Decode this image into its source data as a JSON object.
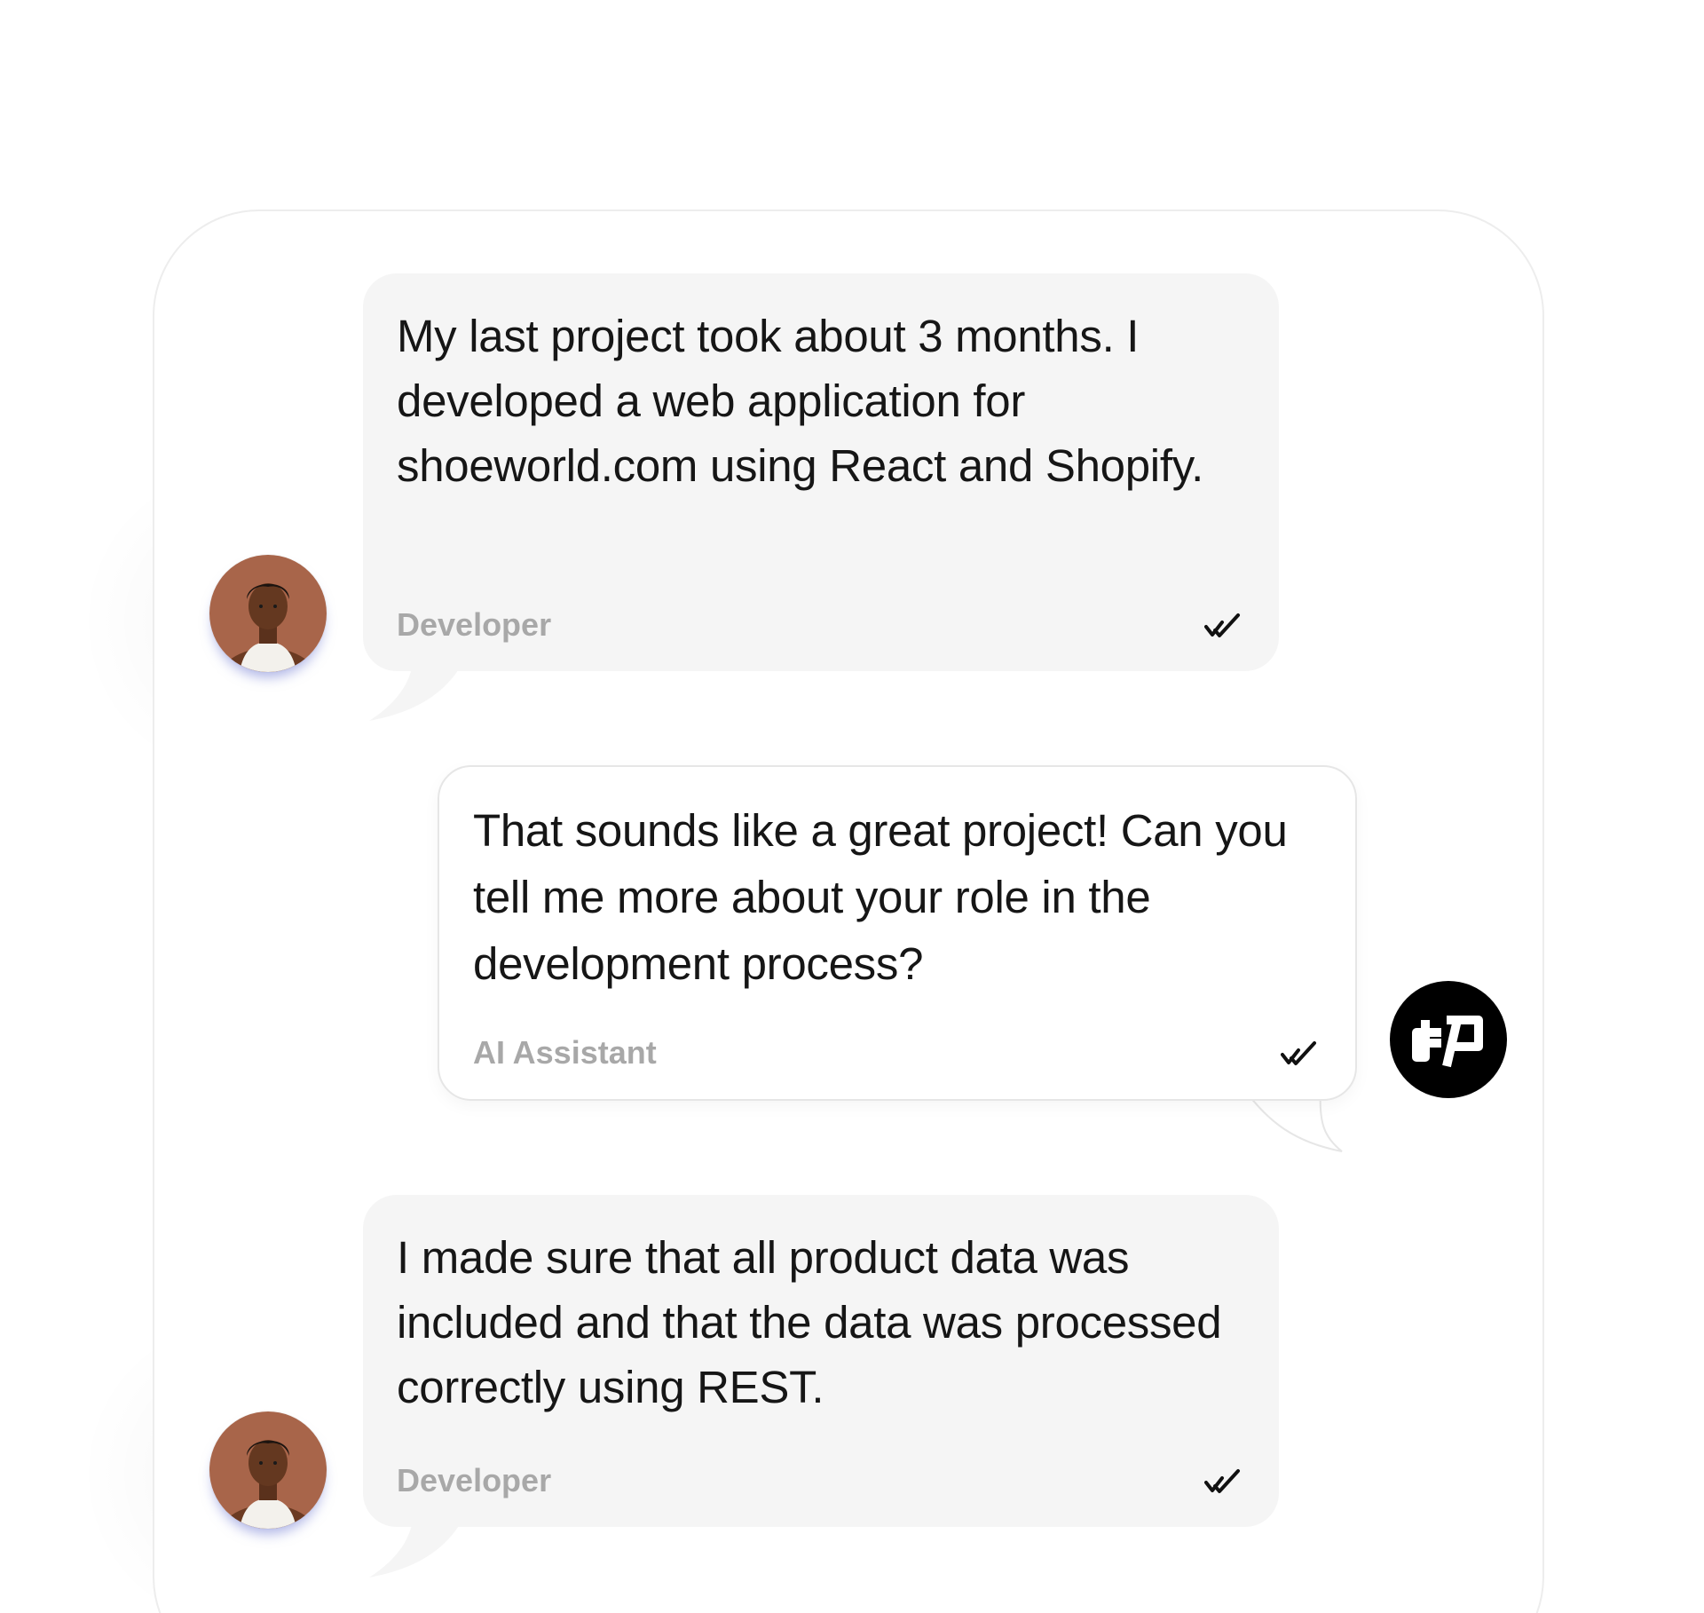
{
  "messages": [
    {
      "text": "My last project took about 3 months. I developed a web application for shoeworld.com using React and Shopify.",
      "sender": "Developer",
      "status_icon": "double-check-icon",
      "avatar_icon": "developer-avatar-photo"
    },
    {
      "text": "That sounds like a great project! Can you tell me more about your role in the development process?",
      "sender": "AI Assistant",
      "status_icon": "double-check-icon",
      "avatar_icon": "dp-logo-icon"
    },
    {
      "text": "I made sure that all product data was included and that the data was processed correctly using REST.",
      "sender": "Developer",
      "status_icon": "double-check-icon",
      "avatar_icon": "developer-avatar-photo"
    }
  ],
  "colors": {
    "incoming_bubble": "#f5f5f5",
    "outgoing_bubble": "#ffffff",
    "text": "#161616",
    "sender_label": "#a8a8a8",
    "ai_avatar_bg": "#000000",
    "avatar_skin_bg": "#a8654a"
  }
}
